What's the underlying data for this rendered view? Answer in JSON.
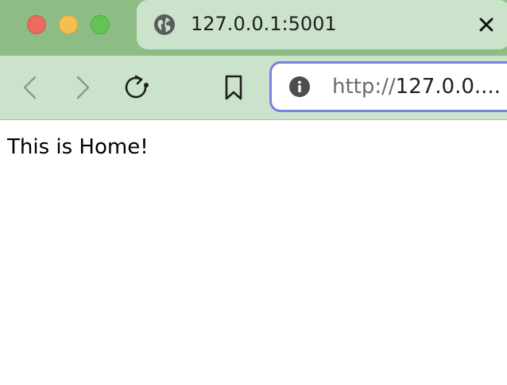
{
  "window": {
    "controls": [
      "close",
      "minimize",
      "maximize"
    ]
  },
  "tab": {
    "icon": "globe-icon",
    "title": "127.0.0.1:5001",
    "close_icon": "close-icon"
  },
  "toolbar": {
    "icons": [
      "chevron-left-icon",
      "chevron-right-icon",
      "reload-icon",
      "bookmark-icon"
    ]
  },
  "address_bar": {
    "icon": "info-icon",
    "scheme": "http://",
    "host": "127.0.0....",
    "focus_color": "#7b81e0"
  },
  "page": {
    "text": "This is Home!"
  },
  "colors": {
    "tab_strip": "#8dbd85",
    "toolbar": "#cbe3ca",
    "traffic_close": "#ec6a5e",
    "traffic_minimize": "#f4bf4f",
    "traffic_maximize": "#61c554"
  }
}
